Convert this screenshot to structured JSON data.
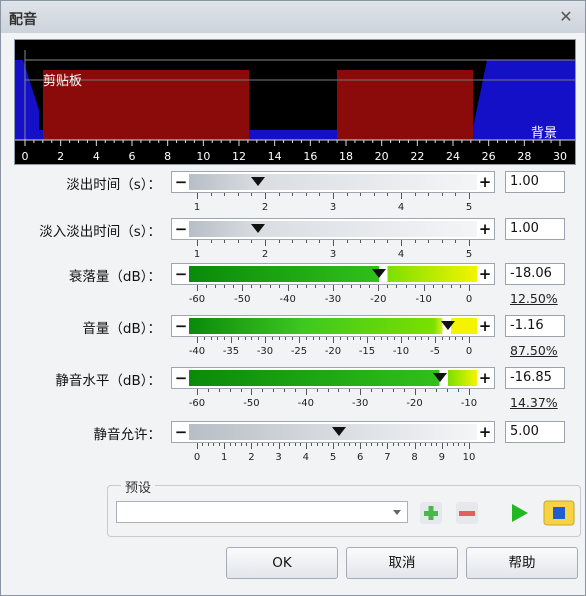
{
  "window": {
    "title": "配音",
    "close_glyph": "✕"
  },
  "preview": {
    "clip_label": "剪贴板",
    "background_label": "背景",
    "axis_ticks": [
      "0",
      "2",
      "4",
      "6",
      "8",
      "10",
      "12",
      "14",
      "16",
      "18",
      "20",
      "22",
      "24",
      "26",
      "28",
      "30"
    ]
  },
  "controls": [
    {
      "label": "淡出时间（s）：",
      "value": "1.00",
      "scale": [
        "1",
        "2",
        "3",
        "4",
        "5"
      ],
      "percent": ""
    },
    {
      "label": "淡入淡出时间（s）：",
      "value": "1.00",
      "scale": [
        "1",
        "2",
        "3",
        "4",
        "5"
      ],
      "percent": ""
    },
    {
      "label": "衰落量（dB）：",
      "value": "-18.06",
      "scale": [
        "-60",
        "-50",
        "-40",
        "-30",
        "-20",
        "-10",
        "0"
      ],
      "percent": "12.50%"
    },
    {
      "label": "音量（dB）：",
      "value": "-1.16",
      "scale": [
        "-40",
        "-35",
        "-30",
        "-25",
        "-20",
        "-15",
        "-10",
        "-5",
        "0"
      ],
      "percent": "87.50%"
    },
    {
      "label": "静音水平（dB）：",
      "value": "-16.85",
      "scale": [
        "-60",
        "-50",
        "-40",
        "-30",
        "-20",
        "-10"
      ],
      "percent": "14.37%"
    },
    {
      "label": "静音允许：",
      "value": "5.00",
      "scale": [
        "0",
        "1",
        "2",
        "3",
        "4",
        "5",
        "6",
        "7",
        "8",
        "9",
        "10"
      ],
      "percent": ""
    }
  ],
  "slider_buttons": {
    "minus": "−",
    "plus": "+"
  },
  "preset": {
    "label": "预设",
    "value": ""
  },
  "buttons": {
    "ok": "OK",
    "cancel": "取消",
    "help": "帮助"
  },
  "colors": {
    "clip_red": "#8b0a0a",
    "envelope_blue": "#1410c8",
    "green_dark": "#0a8a0a",
    "green_light": "#7be000",
    "yellow": "#f4f400"
  }
}
